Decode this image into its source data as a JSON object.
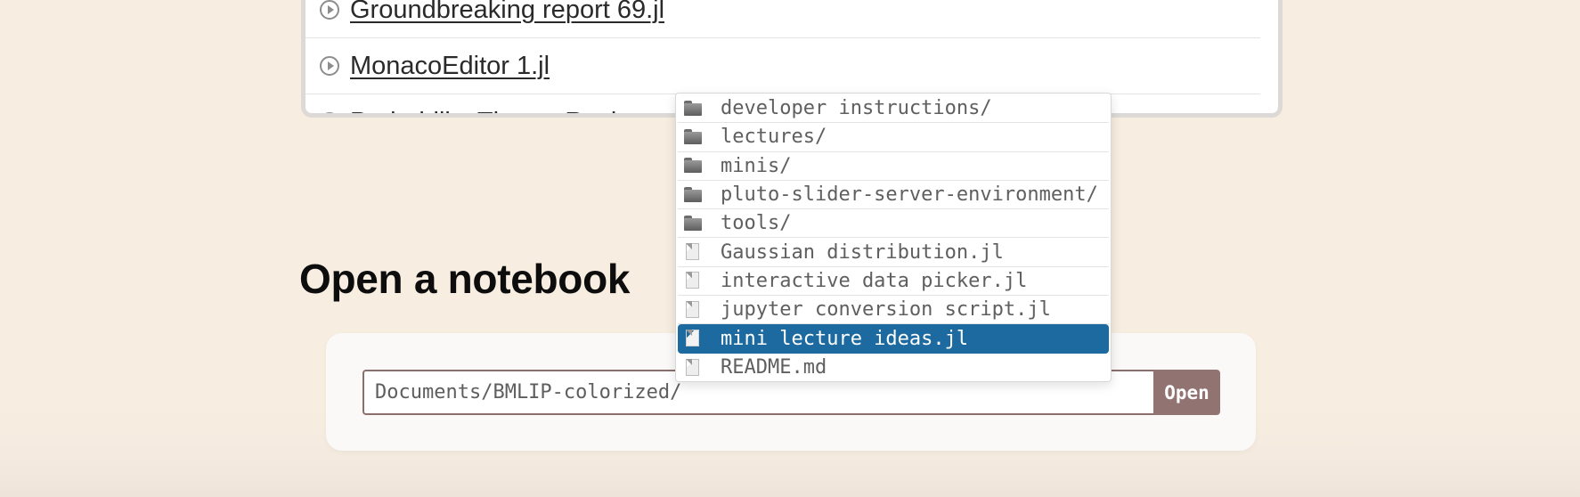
{
  "recent_notebooks": [
    {
      "name": "Groundbreaking report 69.jl",
      "underlined": true
    },
    {
      "name": "MonacoEditor 1.jl",
      "underlined": true
    },
    {
      "name": "Probability Theory Review",
      "underlined": false
    }
  ],
  "open_section": {
    "title": "Open a notebook",
    "path_value": "Documents/BMLIP-colorized/",
    "open_label": "Open"
  },
  "suggestions": [
    {
      "label": "developer instructions/",
      "kind": "folder"
    },
    {
      "label": "lectures/",
      "kind": "folder"
    },
    {
      "label": "minis/",
      "kind": "folder"
    },
    {
      "label": "pluto-slider-server-environment/",
      "kind": "folder"
    },
    {
      "label": "tools/",
      "kind": "folder"
    },
    {
      "label": "Gaussian distribution.jl",
      "kind": "file"
    },
    {
      "label": "interactive data picker.jl",
      "kind": "file"
    },
    {
      "label": "jupyter conversion script.jl",
      "kind": "file"
    },
    {
      "label": "mini lecture ideas.jl",
      "kind": "file",
      "selected": true
    },
    {
      "label": "README.md",
      "kind": "file"
    }
  ],
  "colors": {
    "background": "#f7ede0",
    "accent_button": "#917472",
    "selected_suggestion": "#1d6aa1"
  }
}
